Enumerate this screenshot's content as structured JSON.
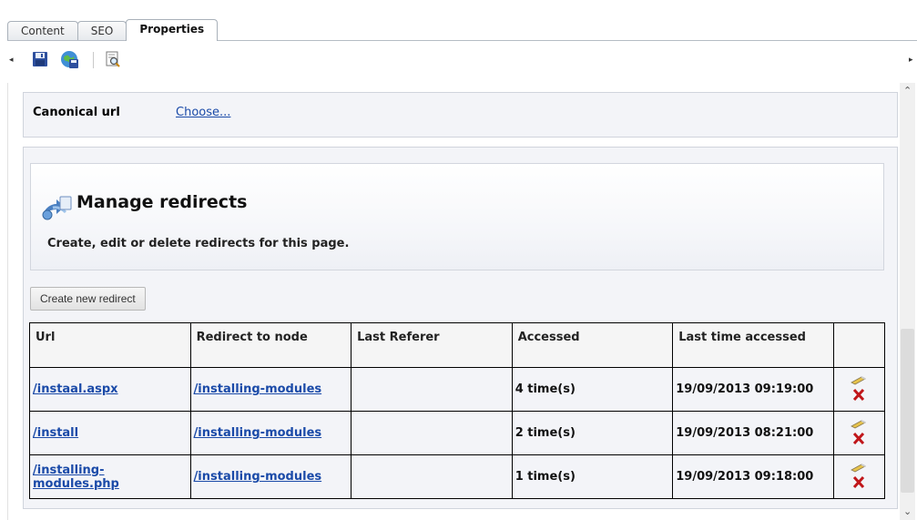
{
  "tabs": [
    {
      "label": "Content"
    },
    {
      "label": "SEO"
    },
    {
      "label": "Properties"
    }
  ],
  "toolbar": {
    "buttons": [
      "save-icon",
      "save-publish-icon",
      "preview-icon"
    ]
  },
  "canonical": {
    "label": "Canonical url",
    "link": "Choose..."
  },
  "redirects": {
    "title": "Manage redirects",
    "subtitle": "Create, edit or delete redirects for this page.",
    "new_button": "Create new redirect",
    "columns": [
      "Url",
      "Redirect to node",
      "Last Referer",
      "Accessed",
      "Last time accessed",
      ""
    ],
    "rows": [
      {
        "url": "/instaal.aspx",
        "node": "/installing-modules",
        "referer": "",
        "accessed": "4 time(s)",
        "last": "19/09/2013 09:19:00"
      },
      {
        "url": "/install",
        "node": "/installing-modules",
        "referer": "",
        "accessed": "2 time(s)",
        "last": "19/09/2013 08:21:00"
      },
      {
        "url": "/installing-modules.php",
        "node": "/installing-modules",
        "referer": "",
        "accessed": "1 time(s)",
        "last": "19/09/2013 09:18:00"
      }
    ]
  },
  "colors": {
    "link": "#1a4aa8",
    "panel": "#f3f4f8",
    "delete": "#c0161a"
  }
}
